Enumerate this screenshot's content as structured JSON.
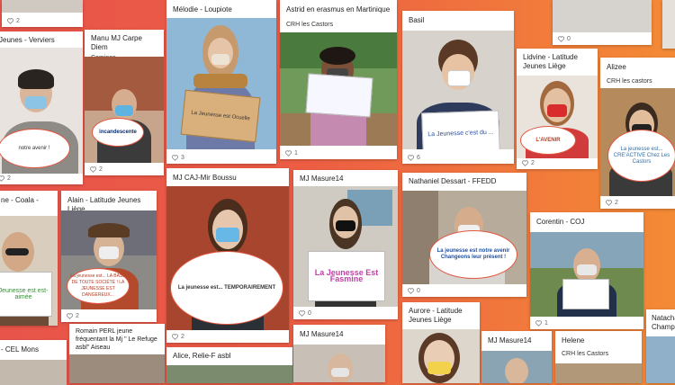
{
  "cards": [
    {
      "id": "c1",
      "title": "",
      "likes": "2"
    },
    {
      "id": "c2",
      "title": "Jeunes - Verviers",
      "likes": "2"
    },
    {
      "id": "c3",
      "title": "Manu MJ Carpe Diem",
      "subtitle": "Comines",
      "likes": "2"
    },
    {
      "id": "c4",
      "title": "Mélodie - Loupiote",
      "likes": "3"
    },
    {
      "id": "c5",
      "title": "Astrid en erasmus en Martinique",
      "likes": "1"
    },
    {
      "id": "c6",
      "title": "Basil",
      "likes": "6"
    },
    {
      "id": "c7",
      "title": "Lidvine - Latitude Jeunes Liège",
      "likes": "2"
    },
    {
      "id": "c8",
      "title": "Alizee",
      "subtitle": "CRH les castors",
      "likes": "2"
    },
    {
      "id": "c9",
      "title": "",
      "likes": "0"
    },
    {
      "id": "c10",
      "title": "ne - Coala -",
      "likes": ""
    },
    {
      "id": "c11",
      "title": "Alain - Latitude Jeunes Liège",
      "likes": "2"
    },
    {
      "id": "c12",
      "title": "MJ CAJ-Mir Boussu",
      "likes": "2"
    },
    {
      "id": "c13",
      "title": "MJ Masure14",
      "likes": "0"
    },
    {
      "id": "c14",
      "title": "Nathaniel Dessart - FFEDD",
      "likes": "0"
    },
    {
      "id": "c15",
      "title": "Corentin - COJ",
      "likes": "1"
    },
    {
      "id": "c16",
      "title": "- CEL Mons",
      "likes": ""
    },
    {
      "id": "c17",
      "title": "Romain PERL jeune fréquentant la Mj \" Le Refuge asbl\" Aiseau",
      "likes": ""
    },
    {
      "id": "c18",
      "title": "Alice, Relie-F asbl",
      "likes": ""
    },
    {
      "id": "c19",
      "title": "MJ Masure14",
      "likes": ""
    },
    {
      "id": "c20",
      "title": "Aurore - Latitude Jeunes Liège",
      "likes": ""
    },
    {
      "id": "c21",
      "title": "MJ Masure14",
      "likes": ""
    },
    {
      "id": "c22",
      "title": "Helene",
      "subtitle": "CRH les Castors",
      "likes": ""
    },
    {
      "id": "c23",
      "title": "Natacha Champi",
      "likes": ""
    }
  ],
  "mel_sub": "",
  "astrid_sub": "CRH les Castors",
  "signs": {
    "s1": "notre avenir !",
    "s2": "incandescente",
    "s3": "La Jeunesse est Ocuelle",
    "s4": "La Jeunesse c'est du ...",
    "s5": "L'AVENIR",
    "s6": "La jeunesse est... CRE'ACTIVE Chez Les Castors",
    "s7": "Jeunesse est est-aimée",
    "s8": "La jeunesse est... LA BASE DE TOUTE SOCIÉTÉ ! LA JEUNESSE EST DANGEREUX...",
    "s9": "La jeunesse est... TEMPORAIREMENT",
    "s10": "La Jeunesse Est Fasmine",
    "s11": "La jeunesse est notre avenir Changeons leur présent !"
  },
  "colors": {
    "heart": "#8a8a8a",
    "accent": "#e2553f"
  }
}
